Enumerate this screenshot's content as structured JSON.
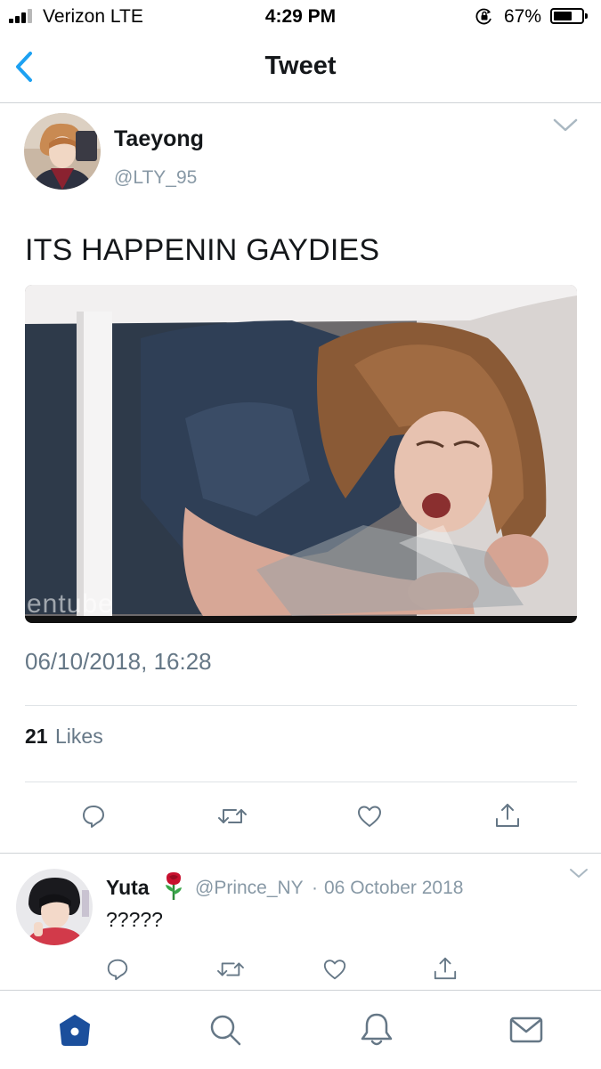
{
  "status_bar": {
    "carrier": "Verizon  LTE",
    "time": "4:29 PM",
    "battery": "67%",
    "battery_level": 0.67,
    "icons": [
      "signal-icon",
      "orientation-lock-icon",
      "battery-icon"
    ]
  },
  "nav": {
    "title": "Tweet",
    "back_icon": "chevron-left-icon"
  },
  "tweet": {
    "author_name": "Taeyong",
    "author_handle": "@LTY_95",
    "text": "ITS HAPPENIN GAYDIES",
    "media_watermark": "entube",
    "timestamp": "06/10/2018, 16:28",
    "likes_count": "21",
    "likes_label": "Likes",
    "actions": [
      "reply-icon",
      "retweet-icon",
      "like-icon",
      "share-icon"
    ]
  },
  "reply": {
    "author_name": "Yuta",
    "author_emoji": "rose-icon",
    "author_handle": "@Prince_NY",
    "separator": "·",
    "date": "06 October 2018",
    "text": "?????"
  },
  "tab_bar": {
    "items": [
      "home-icon",
      "search-icon",
      "notifications-icon",
      "messages-icon"
    ],
    "active": "home-icon"
  },
  "colors": {
    "accent": "#1da1f2",
    "home_active": "#1b4f9c",
    "text": "#14171a",
    "secondary": "#657786",
    "muted": "#8899a6",
    "divider": "#dfe3e6"
  }
}
